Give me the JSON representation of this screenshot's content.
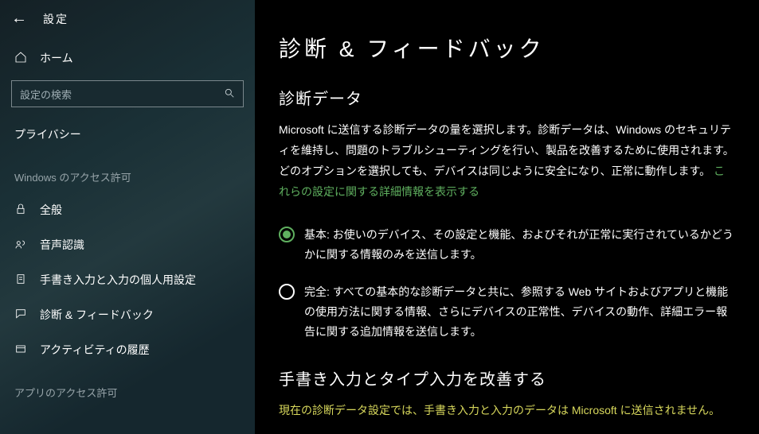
{
  "header": {
    "settings_title": "設定"
  },
  "sidebar": {
    "home_label": "ホーム",
    "search_placeholder": "設定の検索",
    "category_label": "プライバシー",
    "section_heading": "Windows のアクセス許可",
    "items": [
      {
        "label": "全般"
      },
      {
        "label": "音声認識"
      },
      {
        "label": "手書き入力と入力の個人用設定"
      },
      {
        "label": "診断 & フィードバック"
      },
      {
        "label": "アクティビティの履歴"
      }
    ],
    "bottom_heading": "アプリのアクセス許可"
  },
  "main": {
    "page_title": "診断 & フィードバック",
    "section1_heading": "診断データ",
    "section1_body": "Microsoft に送信する診断データの量を選択します。診断データは、Windows のセキュリティを維持し、問題のトラブルシューティングを行い、製品を改善するために使用されます。どのオプションを選択しても、デバイスは同じように安全になり、正常に動作します。",
    "section1_link": "これらの設定に関する詳細情報を表示する",
    "radios": [
      {
        "label": "基本: お使いのデバイス、その設定と機能、およびそれが正常に実行されているかどうかに関する情報のみを送信します。",
        "selected": true
      },
      {
        "label": "完全: すべての基本的な診断データと共に、参照する Web サイトおよびアプリと機能の使用方法に関する情報、さらにデバイスの正常性、デバイスの動作、詳細エラー報告に関する追加情報を送信します。",
        "selected": false
      }
    ],
    "section2_heading": "手書き入力とタイプ入力を改善する",
    "section2_warn": "現在の診断データ設定では、手書き入力と入力のデータは Microsoft に送信されません。"
  }
}
